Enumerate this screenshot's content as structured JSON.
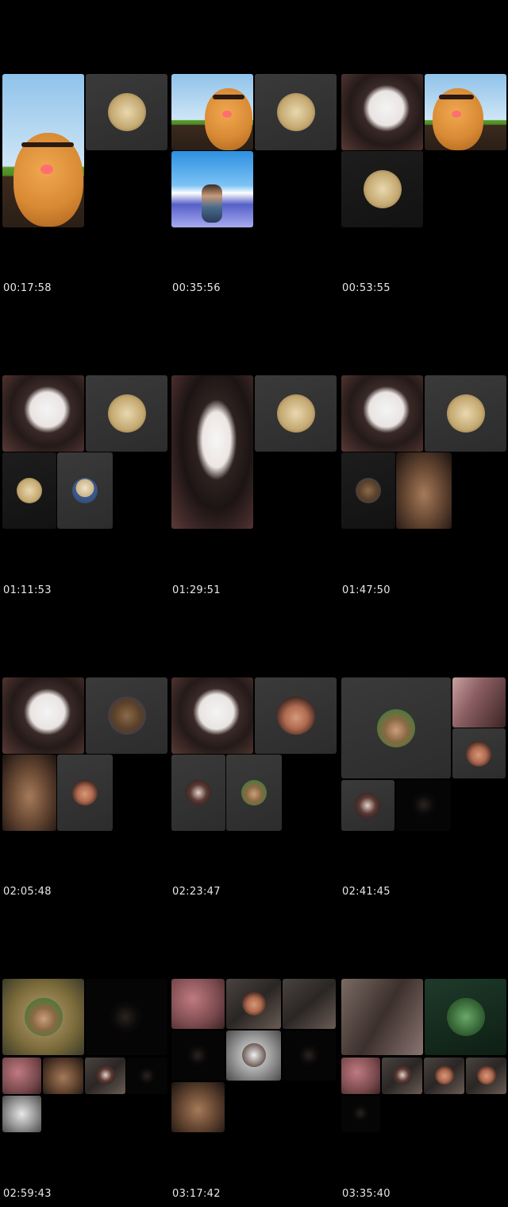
{
  "frames": [
    {
      "timestamp": "00:17:58"
    },
    {
      "timestamp": "00:35:56"
    },
    {
      "timestamp": "00:53:55"
    },
    {
      "timestamp": "01:11:53"
    },
    {
      "timestamp": "01:29:51"
    },
    {
      "timestamp": "01:47:50"
    },
    {
      "timestamp": "02:05:48"
    },
    {
      "timestamp": "02:23:47"
    },
    {
      "timestamp": "02:41:45"
    },
    {
      "timestamp": "02:59:43"
    },
    {
      "timestamp": "03:17:42"
    },
    {
      "timestamp": "03:35:40"
    }
  ],
  "colors": {
    "background": "#000000",
    "tile_dark": "#333333",
    "timestamp_text": "#e8e8e8"
  }
}
